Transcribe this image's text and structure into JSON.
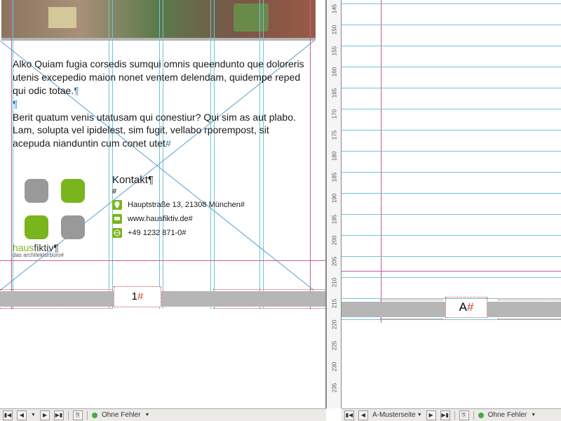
{
  "ruler_marks": [
    "145",
    "150",
    "155",
    "160",
    "165",
    "170",
    "175",
    "180",
    "185",
    "190",
    "195",
    "200",
    "205",
    "210",
    "215",
    "220",
    "225",
    "230",
    "235"
  ],
  "body": {
    "p1": "Alko Quiam fugia corsedis sumqui omnis queendunto que doloreris utenis excepedio maion nonet ventem delendam, quidempe reped qui odic totae.",
    "p2": "Berit quatum venis utatusam qui conestiur? Qui sim as aut plabo. Lam, solupta vel ipidelest, sim fugit, vellabo rporempost, sit acepuda nianduntin cum conet utet"
  },
  "contact": {
    "heading": "Kontakt",
    "address": "Hauptstraße 13, 21308 München",
    "web": "www.hausfiktiv.de",
    "phone": "+49 1232 871-0"
  },
  "logo": {
    "name1a": "haus",
    "name1b": "fiktiv",
    "tagline": "das architekturbüro"
  },
  "page_number": "1",
  "master_marker": "A",
  "hash": "#",
  "para": "¶",
  "status": {
    "error_label": "Ohne Fehler",
    "master_label": "A-Musterseite"
  }
}
